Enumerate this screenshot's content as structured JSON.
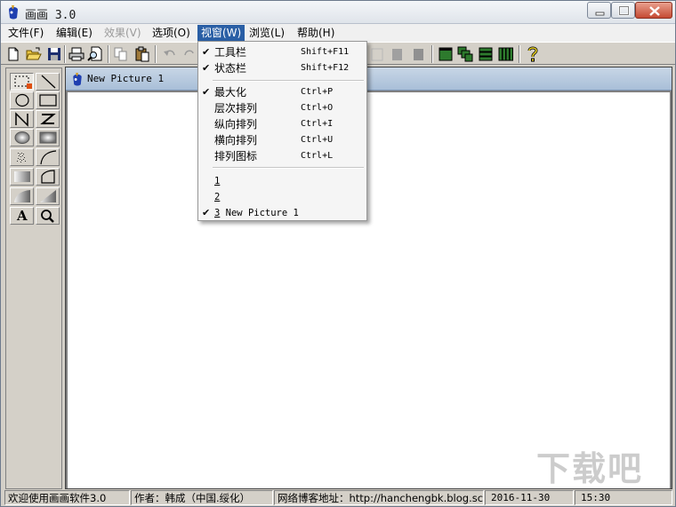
{
  "window": {
    "title": "画画 3.0"
  },
  "menubar": {
    "items": [
      {
        "label": "文件(F)"
      },
      {
        "label": "编辑(E)"
      },
      {
        "label": "效果(V)"
      },
      {
        "label": "选项(O)"
      },
      {
        "label": "视窗(W)"
      },
      {
        "label": "浏览(L)"
      },
      {
        "label": "帮助(H)"
      }
    ]
  },
  "window_menu": {
    "items": [
      {
        "check": "✔",
        "label": "工具栏",
        "shortcut": "Shift+F11"
      },
      {
        "check": "✔",
        "label": "状态栏",
        "shortcut": "Shift+F12"
      },
      {
        "check": "✔",
        "label": "最大化",
        "shortcut": "Ctrl+P"
      },
      {
        "check": "",
        "label": "层次排列",
        "shortcut": "Ctrl+O"
      },
      {
        "check": "",
        "label": "纵向排列",
        "shortcut": "Ctrl+I"
      },
      {
        "check": "",
        "label": "横向排列",
        "shortcut": "Ctrl+U"
      },
      {
        "check": "",
        "label": "排列图标",
        "shortcut": "Ctrl+L"
      }
    ],
    "windows": [
      {
        "check": "",
        "number": "1",
        "name": ""
      },
      {
        "check": "",
        "number": "2",
        "name": ""
      },
      {
        "check": "✔",
        "number": "3",
        "name": "New Picture 1"
      }
    ]
  },
  "document": {
    "title": "New Picture 1"
  },
  "palette": {
    "text_tool_glyph": "A"
  },
  "statusbar": {
    "welcome": "欢迎使用画画软件3.0",
    "author": "作者：韩成（中国.绥化）",
    "blog": "网络博客地址：http://hanchengbk.blog.sc",
    "date": "2016-11-30",
    "time": "15:30"
  },
  "watermark": {
    "text": "下载吧"
  },
  "colors": {
    "menu_highlight": "#2a5fa5",
    "face": "#d4d0c8",
    "workspace": "#808080"
  }
}
